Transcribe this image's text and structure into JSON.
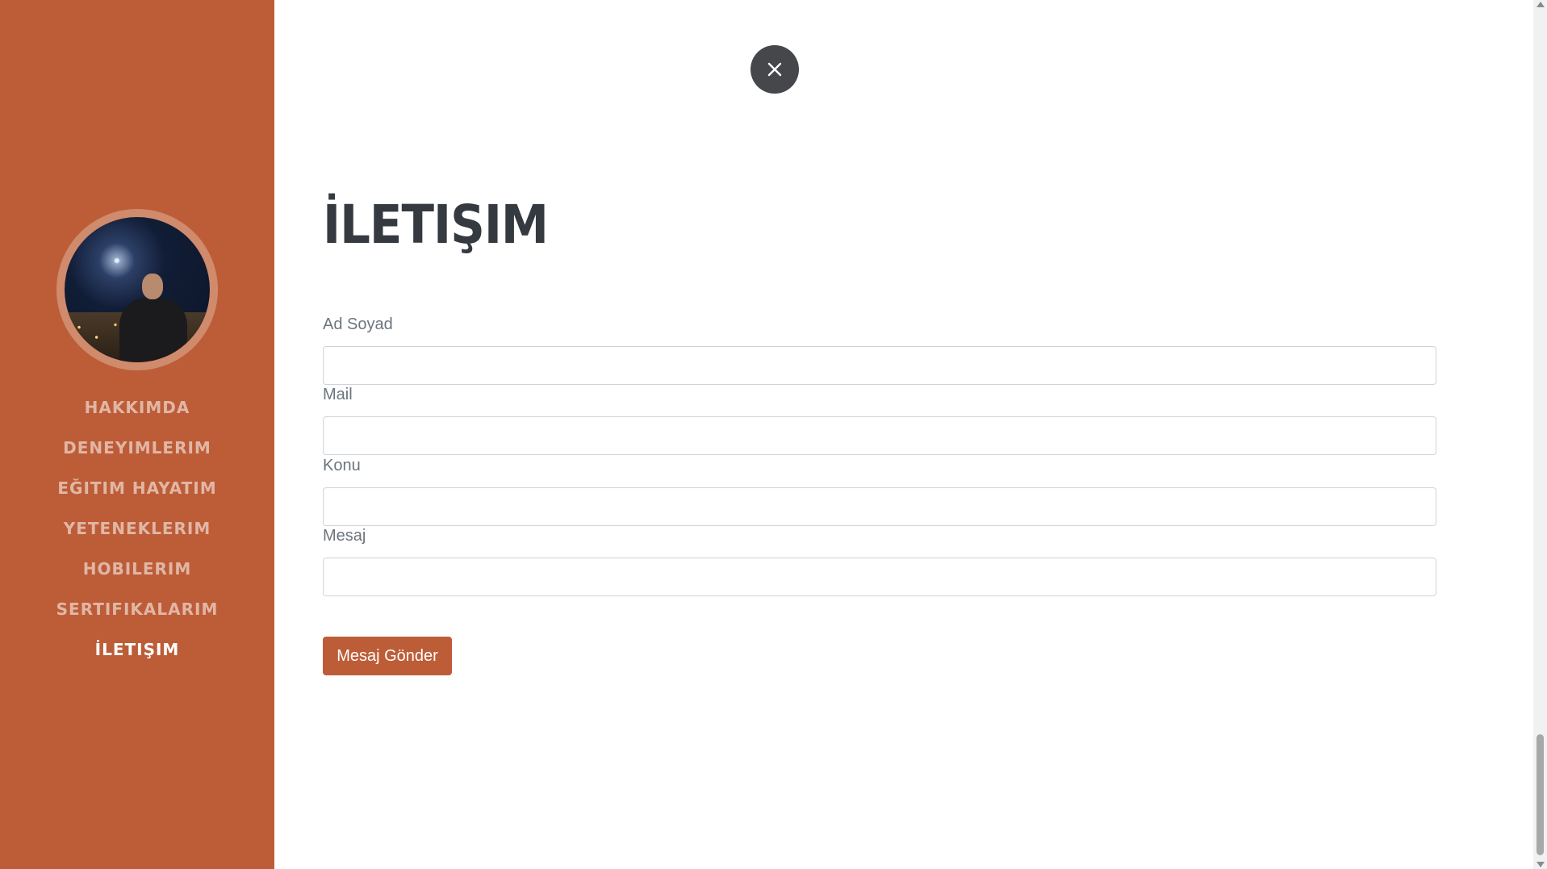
{
  "colors": {
    "accent": "#bd5d38",
    "heading": "#343a40",
    "label": "#6c757d",
    "close_button": "#45474a"
  },
  "sidebar": {
    "avatar": "profile-photo",
    "items": [
      {
        "label": "HAKKIMDA",
        "active": false
      },
      {
        "label": "DENEYIMLERIM",
        "active": false
      },
      {
        "label": "EĞITIM HAYATIM",
        "active": false
      },
      {
        "label": "YETENEKLERIM",
        "active": false
      },
      {
        "label": "HOBILERIM",
        "active": false
      },
      {
        "label": "SERTIFIKALARIM",
        "active": false
      },
      {
        "label": "İLETIŞIM",
        "active": true
      }
    ]
  },
  "close_button": {
    "icon": "close-icon"
  },
  "main": {
    "title": "İLETIŞIM",
    "form": {
      "fields": [
        {
          "label": "Ad Soyad",
          "value": ""
        },
        {
          "label": "Mail",
          "value": ""
        },
        {
          "label": "Konu",
          "value": ""
        },
        {
          "label": "Mesaj",
          "value": ""
        }
      ],
      "submit_label": "Mesaj Gönder"
    }
  }
}
